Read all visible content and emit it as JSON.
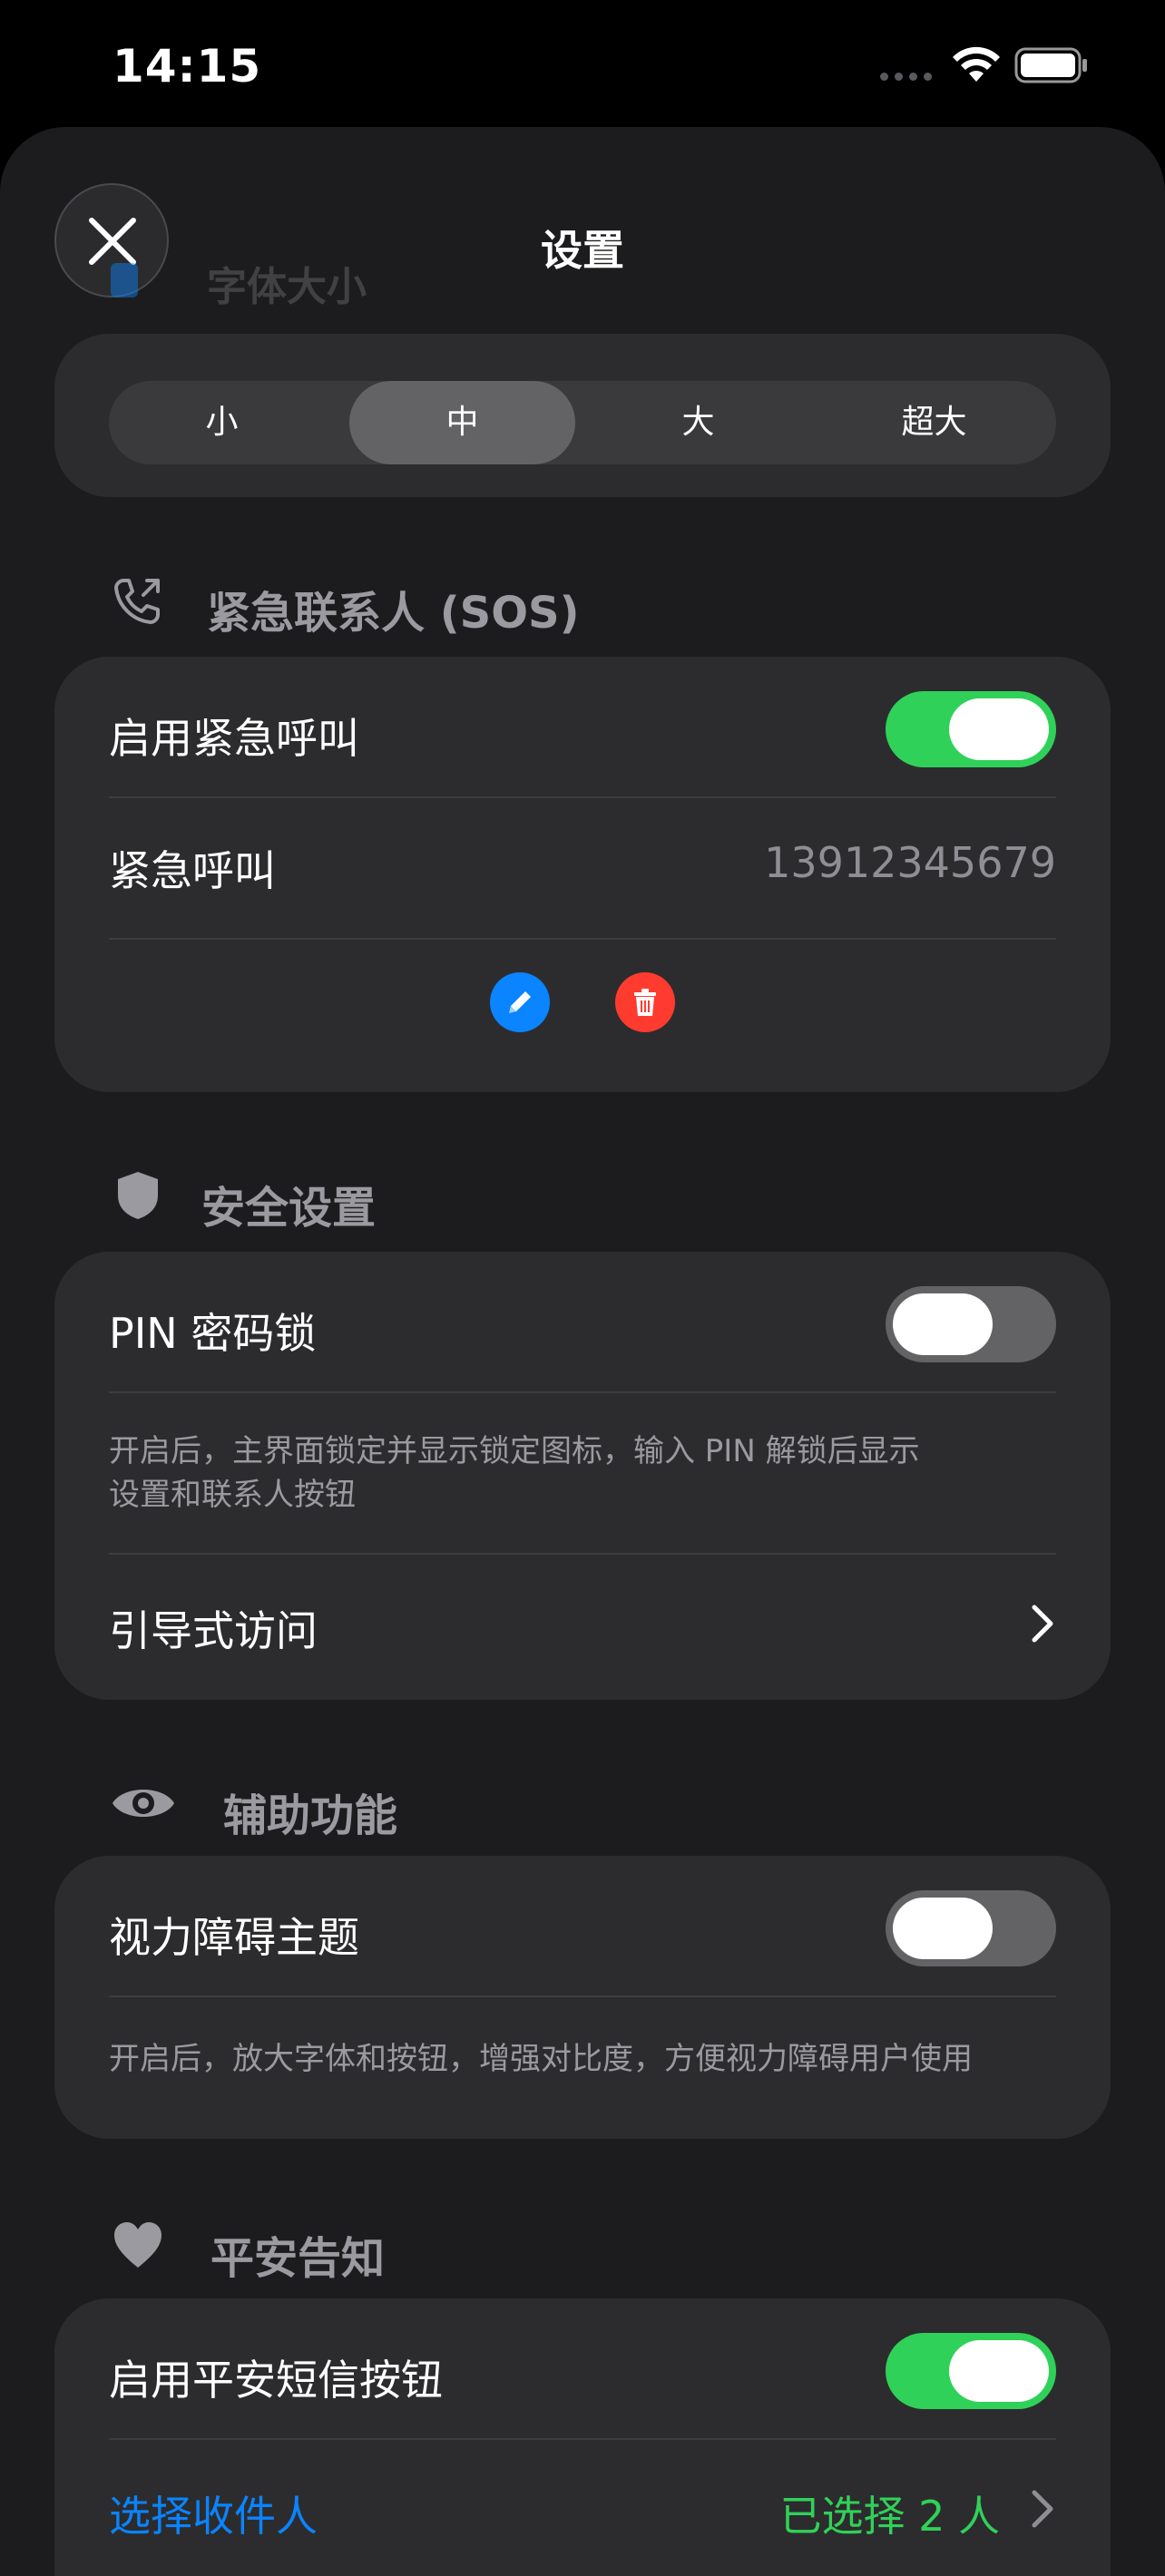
{
  "status_bar": {
    "time": "14:15"
  },
  "sheet": {
    "title": "设置"
  },
  "font_size": {
    "section_label": "字体大小",
    "options": [
      "小",
      "中",
      "大",
      "超大"
    ],
    "selected": "中"
  },
  "sos": {
    "section_label": "紧急联系人 (SOS)",
    "enable_label": "启用紧急呼叫",
    "enable_on": true,
    "contact_label": "紧急呼叫",
    "contact_number": "13912345679"
  },
  "security": {
    "section_label": "安全设置",
    "pin_label": "PIN 密码锁",
    "pin_on": false,
    "pin_desc_line1": "开启后，主界面锁定并显示锁定图标，输入 PIN 解锁后显示",
    "pin_desc_line2": "设置和联系人按钮",
    "guided_access_label": "引导式访问"
  },
  "accessibility": {
    "section_label": "辅助功能",
    "vision_label": "视力障碍主题",
    "vision_on": false,
    "vision_desc": "开启后，放大字体和按钮，增强对比度，方便视力障碍用户使用"
  },
  "safety": {
    "section_label": "平安告知",
    "sms_button_label": "启用平安短信按钮",
    "sms_on": true,
    "recipients_label": "选择收件人",
    "recipients_value": "已选择 2 人"
  },
  "colors": {
    "background": "#1c1c1e",
    "card": "#2c2c2e",
    "toggle_on": "#30d158",
    "toggle_off": "#636366",
    "edit_button": "#0a84ff",
    "delete_button": "#ff3b30",
    "link": "#0a84ff"
  }
}
